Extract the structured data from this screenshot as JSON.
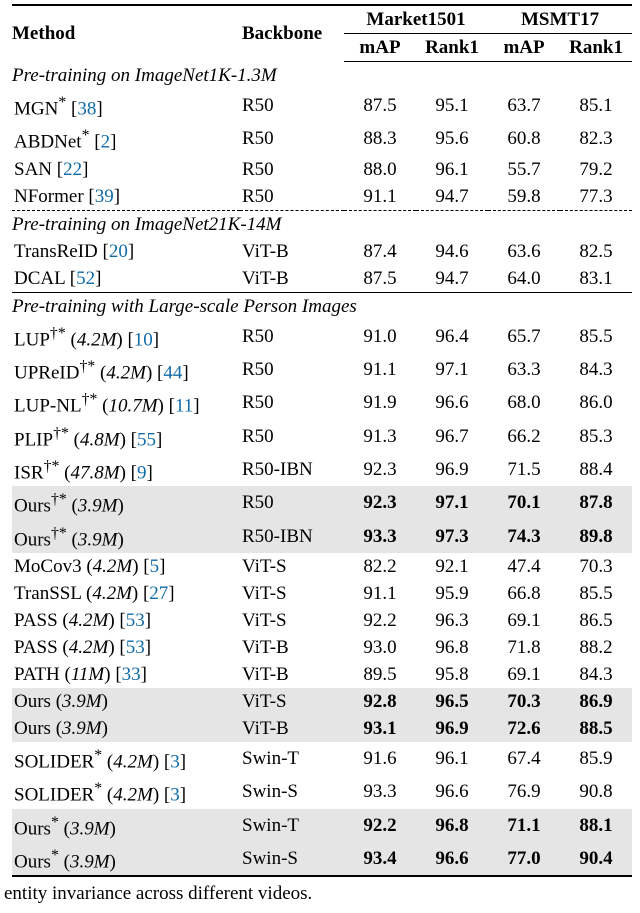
{
  "headers": {
    "method": "Method",
    "backbone": "Backbone",
    "ds1": "Market1501",
    "ds2": "MSMT17",
    "m1": "mAP",
    "m2": "Rank1",
    "m3": "mAP",
    "m4": "Rank1"
  },
  "sections": [
    {
      "title": "Pre-training on ImageNet1K-1.3M",
      "dashed": false,
      "rows": [
        {
          "name": "MGN",
          "sup": "*",
          "extra": "",
          "cite": "38",
          "bb": "R50",
          "v": [
            "87.5",
            "95.1",
            "63.7",
            "85.1"
          ],
          "hl": false,
          "bold": false
        },
        {
          "name": "ABDNet",
          "sup": "*",
          "extra": "",
          "cite": "2",
          "bb": "R50",
          "v": [
            "88.3",
            "95.6",
            "60.8",
            "82.3"
          ],
          "hl": false,
          "bold": false
        },
        {
          "name": "SAN",
          "sup": "",
          "extra": "",
          "cite": "22",
          "bb": "R50",
          "v": [
            "88.0",
            "96.1",
            "55.7",
            "79.2"
          ],
          "hl": false,
          "bold": false
        },
        {
          "name": "NFormer",
          "sup": "",
          "extra": "",
          "cite": "39",
          "bb": "R50",
          "v": [
            "91.1",
            "94.7",
            "59.8",
            "77.3"
          ],
          "hl": false,
          "bold": false
        }
      ]
    },
    {
      "title": "Pre-training on ImageNet21K-14M",
      "dashed": true,
      "rows": [
        {
          "name": "TransReID",
          "sup": "",
          "extra": "",
          "cite": "20",
          "bb": "ViT-B",
          "v": [
            "87.4",
            "94.6",
            "63.6",
            "82.5"
          ],
          "hl": false,
          "bold": false
        },
        {
          "name": "DCAL",
          "sup": "",
          "extra": "",
          "cite": "52",
          "bb": "ViT-B",
          "v": [
            "87.5",
            "94.7",
            "64.0",
            "83.1"
          ],
          "hl": false,
          "bold": false
        }
      ]
    },
    {
      "title": "Pre-training with Large-scale Person Images",
      "dashed": false,
      "rows": [
        {
          "name": "LUP",
          "sup": "†*",
          "extra": "4.2M",
          "cite": "10",
          "bb": "R50",
          "v": [
            "91.0",
            "96.4",
            "65.7",
            "85.5"
          ],
          "hl": false,
          "bold": false
        },
        {
          "name": "UPReID",
          "sup": "†*",
          "extra": "4.2M",
          "cite": "44",
          "bb": "R50",
          "v": [
            "91.1",
            "97.1",
            "63.3",
            "84.3"
          ],
          "hl": false,
          "bold": false
        },
        {
          "name": "LUP-NL",
          "sup": "†*",
          "extra": "10.7M",
          "cite": "11",
          "bb": "R50",
          "v": [
            "91.9",
            "96.6",
            "68.0",
            "86.0"
          ],
          "hl": false,
          "bold": false
        },
        {
          "name": "PLIP",
          "sup": "†*",
          "extra": "4.8M",
          "cite": "55",
          "bb": "R50",
          "v": [
            "91.3",
            "96.7",
            "66.2",
            "85.3"
          ],
          "hl": false,
          "bold": false
        },
        {
          "name": "ISR",
          "sup": "†*",
          "extra": "47.8M",
          "cite": "9",
          "bb": "R50-IBN",
          "v": [
            "92.3",
            "96.9",
            "71.5",
            "88.4"
          ],
          "hl": false,
          "bold": false
        },
        {
          "name": "Ours",
          "sup": "†*",
          "extra": "3.9M",
          "cite": "",
          "bb": "R50",
          "v": [
            "92.3",
            "97.1",
            "70.1",
            "87.8"
          ],
          "hl": true,
          "bold": true
        },
        {
          "name": "Ours",
          "sup": "†*",
          "extra": "3.9M",
          "cite": "",
          "bb": "R50-IBN",
          "v": [
            "93.3",
            "97.3",
            "74.3",
            "89.8"
          ],
          "hl": true,
          "bold": true
        },
        {
          "name": "MoCov3",
          "sup": "",
          "extra": "4.2M",
          "cite": "5",
          "bb": "ViT-S",
          "v": [
            "82.2",
            "92.1",
            "47.4",
            "70.3"
          ],
          "hl": false,
          "bold": false
        },
        {
          "name": "TranSSL",
          "sup": "",
          "extra": "4.2M",
          "cite": "27",
          "bb": "ViT-S",
          "v": [
            "91.1",
            "95.9",
            "66.8",
            "85.5"
          ],
          "hl": false,
          "bold": false
        },
        {
          "name": "PASS",
          "sup": "",
          "extra": "4.2M",
          "cite": "53",
          "bb": "ViT-S",
          "v": [
            "92.2",
            "96.3",
            "69.1",
            "86.5"
          ],
          "hl": false,
          "bold": false
        },
        {
          "name": "PASS",
          "sup": "",
          "extra": "4.2M",
          "cite": "53",
          "bb": "ViT-B",
          "v": [
            "93.0",
            "96.8",
            "71.8",
            "88.2"
          ],
          "hl": false,
          "bold": false
        },
        {
          "name": "PATH",
          "sup": "",
          "extra": "11M",
          "cite": "33",
          "bb": "ViT-B",
          "v": [
            "89.5",
            "95.8",
            "69.1",
            "84.3"
          ],
          "hl": false,
          "bold": false
        },
        {
          "name": "Ours",
          "sup": "",
          "extra": "3.9M",
          "cite": "",
          "bb": "ViT-S",
          "v": [
            "92.8",
            "96.5",
            "70.3",
            "86.9"
          ],
          "hl": true,
          "bold": true
        },
        {
          "name": "Ours",
          "sup": "",
          "extra": "3.9M",
          "cite": "",
          "bb": "ViT-B",
          "v": [
            "93.1",
            "96.9",
            "72.6",
            "88.5"
          ],
          "hl": true,
          "bold": true
        },
        {
          "name": "SOLIDER",
          "sup": "*",
          "extra": "4.2M",
          "cite": "3",
          "bb": "Swin-T",
          "v": [
            "91.6",
            "96.1",
            "67.4",
            "85.9"
          ],
          "hl": false,
          "bold": false
        },
        {
          "name": "SOLIDER",
          "sup": "*",
          "extra": "4.2M",
          "cite": "3",
          "bb": "Swin-S",
          "v": [
            "93.3",
            "96.6",
            "76.9",
            "90.8"
          ],
          "hl": false,
          "bold": false
        },
        {
          "name": "Ours",
          "sup": "*",
          "extra": "3.9M",
          "cite": "",
          "bb": "Swin-T",
          "v": [
            "92.2",
            "96.8",
            "71.1",
            "88.1"
          ],
          "hl": true,
          "bold": true
        },
        {
          "name": "Ours",
          "sup": "*",
          "extra": "3.9M",
          "cite": "",
          "bb": "Swin-S",
          "v": [
            "93.4",
            "96.6",
            "77.0",
            "90.4"
          ],
          "hl": true,
          "bold": true
        }
      ]
    }
  ],
  "caption_fragment": "entity invariance across different videos.",
  "chart_data": {
    "type": "table",
    "title": "",
    "columns": [
      "Method",
      "Backbone",
      "Market1501 mAP",
      "Market1501 Rank1",
      "MSMT17 mAP",
      "MSMT17 Rank1"
    ],
    "groups": [
      {
        "name": "Pre-training on ImageNet1K-1.3M",
        "rows": [
          [
            "MGN*",
            "R50",
            87.5,
            95.1,
            63.7,
            85.1
          ],
          [
            "ABDNet*",
            "R50",
            88.3,
            95.6,
            60.8,
            82.3
          ],
          [
            "SAN",
            "R50",
            88.0,
            96.1,
            55.7,
            79.2
          ],
          [
            "NFormer",
            "R50",
            91.1,
            94.7,
            59.8,
            77.3
          ]
        ]
      },
      {
        "name": "Pre-training on ImageNet21K-14M",
        "rows": [
          [
            "TransReID",
            "ViT-B",
            87.4,
            94.6,
            63.6,
            82.5
          ],
          [
            "DCAL",
            "ViT-B",
            87.5,
            94.7,
            64.0,
            83.1
          ]
        ]
      },
      {
        "name": "Pre-training with Large-scale Person Images",
        "rows": [
          [
            "LUP†* (4.2M)",
            "R50",
            91.0,
            96.4,
            65.7,
            85.5
          ],
          [
            "UPReID†* (4.2M)",
            "R50",
            91.1,
            97.1,
            63.3,
            84.3
          ],
          [
            "LUP-NL†* (10.7M)",
            "R50",
            91.9,
            96.6,
            68.0,
            86.0
          ],
          [
            "PLIP†* (4.8M)",
            "R50",
            91.3,
            96.7,
            66.2,
            85.3
          ],
          [
            "ISR†* (47.8M)",
            "R50-IBN",
            92.3,
            96.9,
            71.5,
            88.4
          ],
          [
            "Ours†* (3.9M)",
            "R50",
            92.3,
            97.1,
            70.1,
            87.8
          ],
          [
            "Ours†* (3.9M)",
            "R50-IBN",
            93.3,
            97.3,
            74.3,
            89.8
          ],
          [
            "MoCov3 (4.2M)",
            "ViT-S",
            82.2,
            92.1,
            47.4,
            70.3
          ],
          [
            "TranSSL (4.2M)",
            "ViT-S",
            91.1,
            95.9,
            66.8,
            85.5
          ],
          [
            "PASS (4.2M)",
            "ViT-S",
            92.2,
            96.3,
            69.1,
            86.5
          ],
          [
            "PASS (4.2M)",
            "ViT-B",
            93.0,
            96.8,
            71.8,
            88.2
          ],
          [
            "PATH (11M)",
            "ViT-B",
            89.5,
            95.8,
            69.1,
            84.3
          ],
          [
            "Ours (3.9M)",
            "ViT-S",
            92.8,
            96.5,
            70.3,
            86.9
          ],
          [
            "Ours (3.9M)",
            "ViT-B",
            93.1,
            96.9,
            72.6,
            88.5
          ],
          [
            "SOLIDER* (4.2M)",
            "Swin-T",
            91.6,
            96.1,
            67.4,
            85.9
          ],
          [
            "SOLIDER* (4.2M)",
            "Swin-S",
            93.3,
            96.6,
            76.9,
            90.8
          ],
          [
            "Ours* (3.9M)",
            "Swin-T",
            92.2,
            96.8,
            71.1,
            88.1
          ],
          [
            "Ours* (3.9M)",
            "Swin-S",
            93.4,
            96.6,
            77.0,
            90.4
          ]
        ]
      }
    ]
  }
}
